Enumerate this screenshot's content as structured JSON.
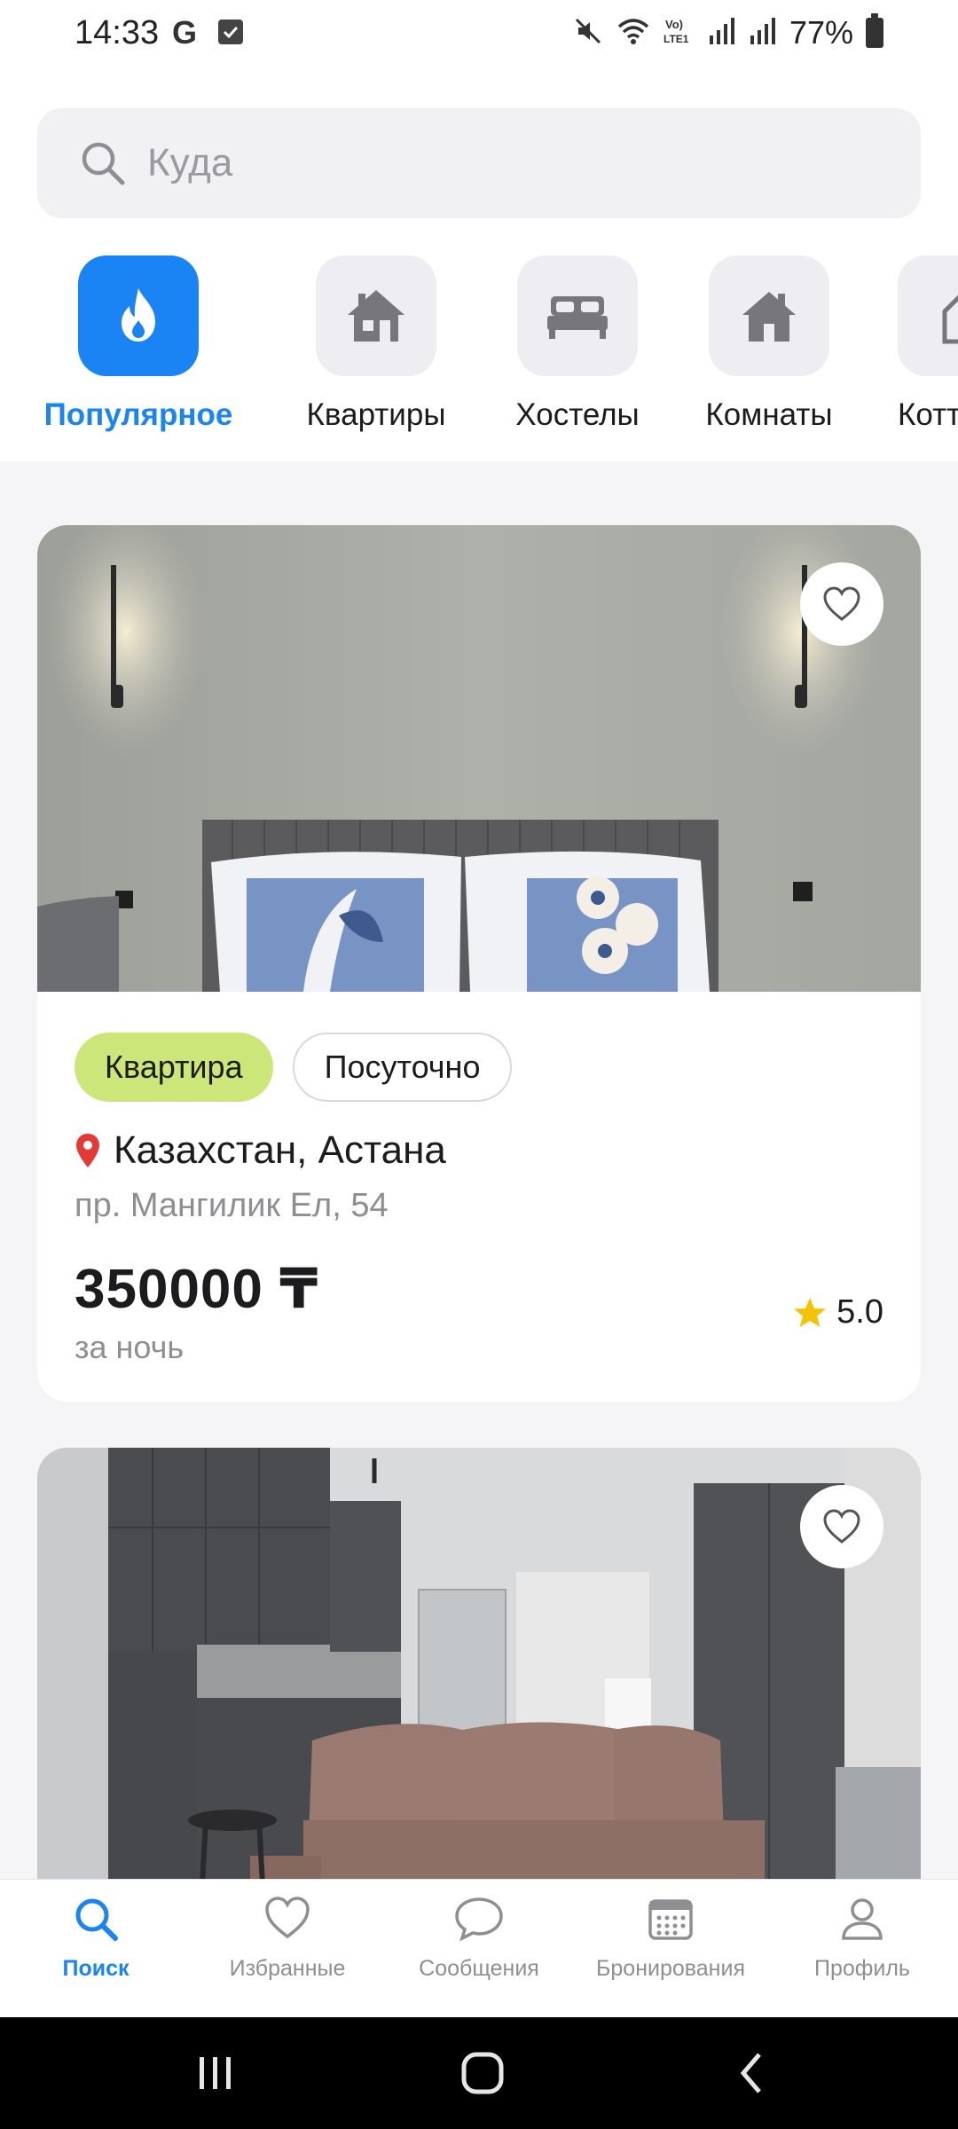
{
  "status_bar": {
    "time": "14:33",
    "g_icon": "G",
    "battery_percent": "77%",
    "icons": [
      "mute-icon",
      "wifi-icon",
      "volte-icon",
      "signal-icon",
      "signal-icon",
      "battery-icon"
    ]
  },
  "search": {
    "placeholder": "Куда"
  },
  "categories": [
    {
      "label": "Популярное",
      "icon": "fire-icon",
      "active": true
    },
    {
      "label": "Квартиры",
      "icon": "house-icon",
      "active": false
    },
    {
      "label": "Хостелы",
      "icon": "bed-icon",
      "active": false
    },
    {
      "label": "Комнаты",
      "icon": "home-door-icon",
      "active": false
    },
    {
      "label": "Котт",
      "icon": "cottage-icon",
      "active": false
    }
  ],
  "listings": [
    {
      "tags": [
        "Квартира",
        "Посуточно"
      ],
      "location": "Казахстан, Астана",
      "address": "пр. Мангилик Ел, 54",
      "price": "350000 ₸",
      "price_period": "за ночь",
      "rating": "5.0"
    },
    {}
  ],
  "bottom_nav": [
    {
      "label": "Поиск",
      "icon": "search-icon",
      "active": true
    },
    {
      "label": "Избранные",
      "icon": "heart-icon",
      "active": false
    },
    {
      "label": "Сообщения",
      "icon": "chat-icon",
      "active": false
    },
    {
      "label": "Бронирования",
      "icon": "calendar-icon",
      "active": false
    },
    {
      "label": "Профиль",
      "icon": "user-icon",
      "active": false
    }
  ],
  "colors": {
    "accent": "#1a84f5",
    "tag_green": "#cde67a",
    "star": "#f5c400",
    "pin": "#e53935"
  }
}
